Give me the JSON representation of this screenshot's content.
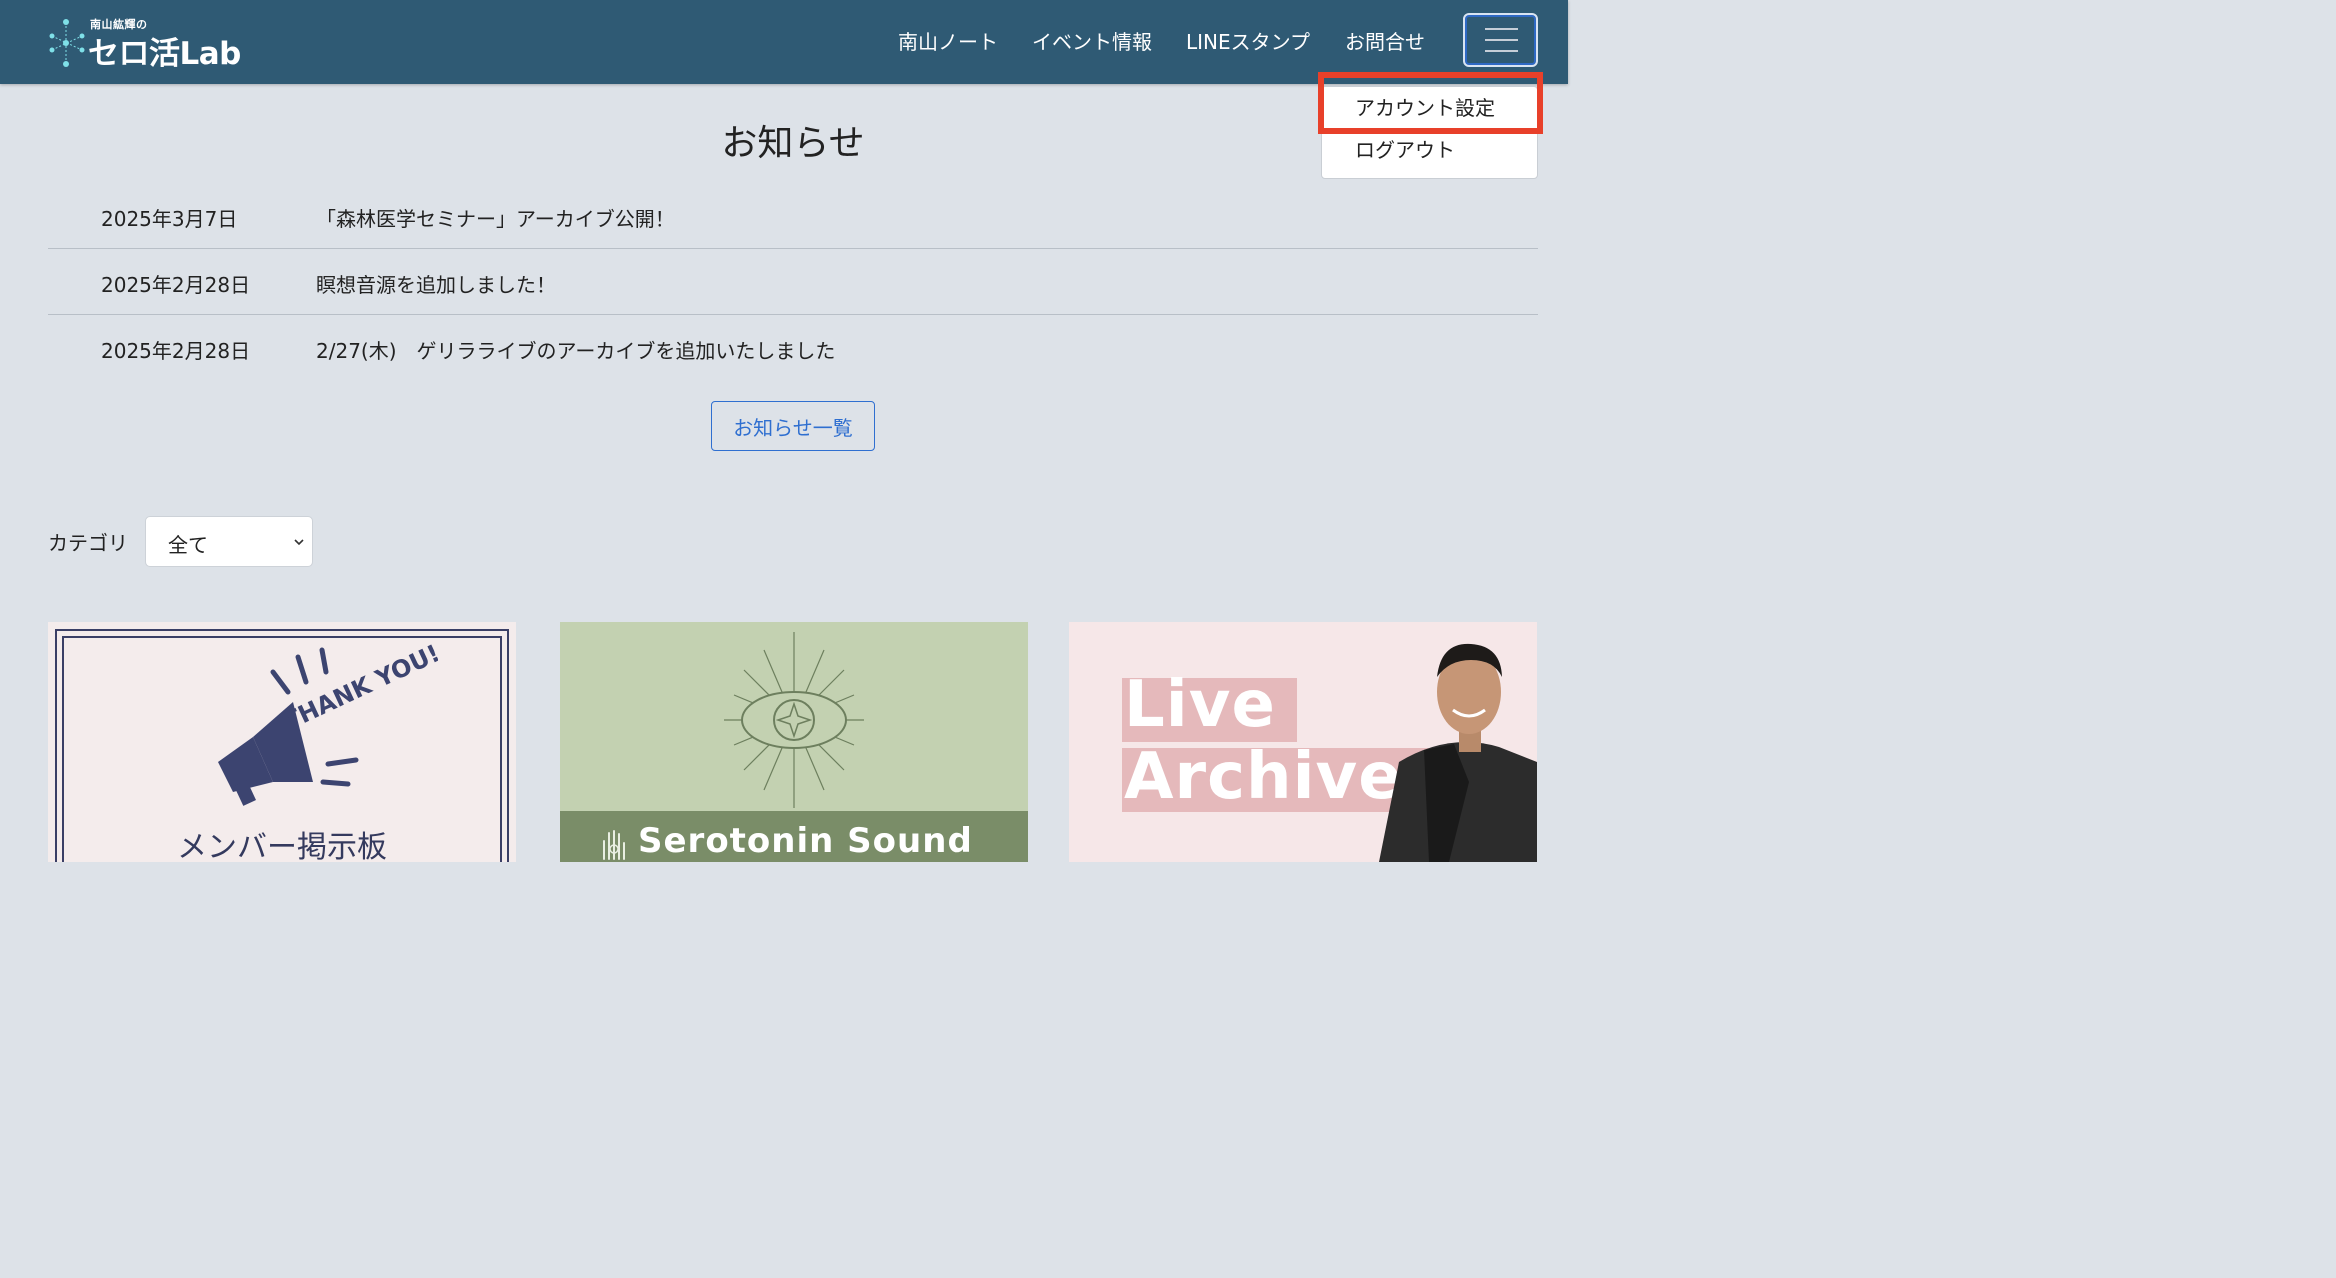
{
  "header": {
    "logo": {
      "subtitle": "南山紘輝の",
      "title": "セロ活Lab"
    },
    "nav": [
      {
        "label": "南山ノート"
      },
      {
        "label": "イベント情報"
      },
      {
        "label": "LINEスタンプ"
      },
      {
        "label": "お問合せ"
      }
    ],
    "menu_icon": "hamburger-icon"
  },
  "dropdown": {
    "items": [
      {
        "label": "アカウント設定"
      },
      {
        "label": "ログアウト"
      }
    ],
    "highlight_color": "#e8402a"
  },
  "notices": {
    "title": "お知らせ",
    "items": [
      {
        "date": "2025年3月7日",
        "title": "「森林医学セミナー」アーカイブ公開！"
      },
      {
        "date": "2025年2月28日",
        "title": "瞑想音源を追加しました！"
      },
      {
        "date": "2025年2月28日",
        "title": "2/27(木)　ゲリラライブのアーカイブを追加いたしました"
      }
    ],
    "more_label": "お知らせ一覧"
  },
  "category": {
    "label": "カテゴリ",
    "selected": "全て"
  },
  "cards": [
    {
      "title": "メンバー掲示板",
      "badge": "THANK YOU!",
      "icon": "megaphone-icon"
    },
    {
      "title": "Serotonin Sound",
      "icon": "eye-icon"
    },
    {
      "line1": "Live",
      "line2": "Archive",
      "icon": "person-photo"
    }
  ],
  "colors": {
    "header_bg": "#2f5a74",
    "page_bg": "#dde2e8",
    "link": "#2f6fd0"
  }
}
